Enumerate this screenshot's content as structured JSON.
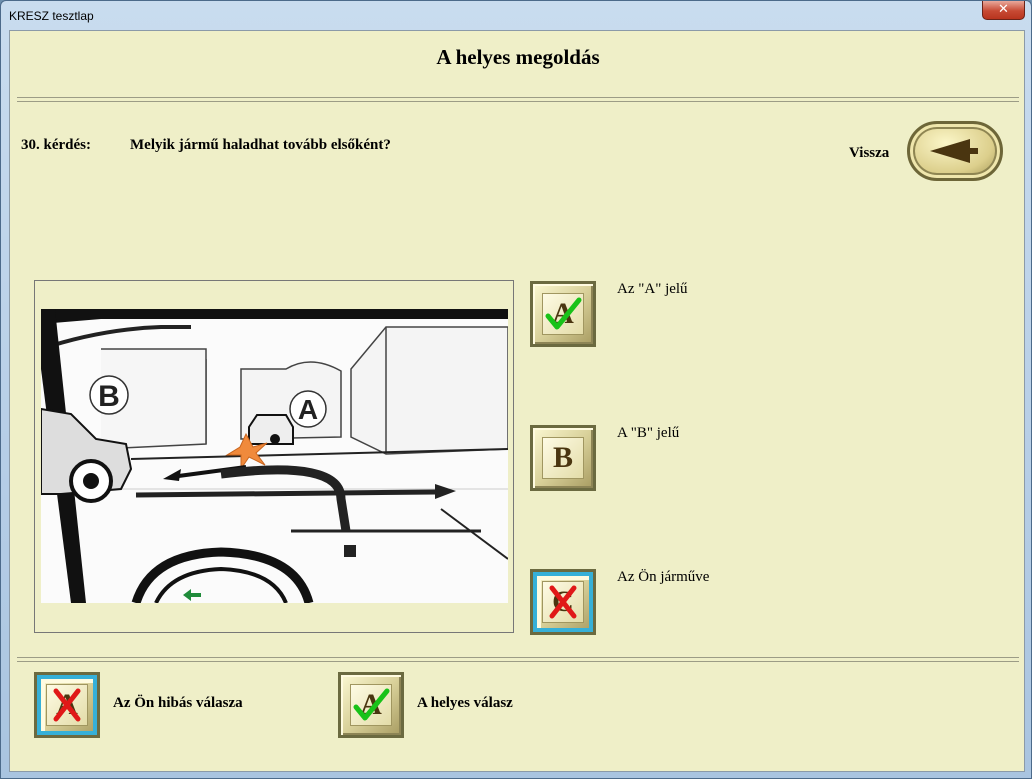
{
  "window": {
    "title": "KRESZ tesztlap",
    "close_glyph": "✕"
  },
  "header": {
    "title": "A helyes megoldás"
  },
  "question": {
    "number": "30.  kérdés:",
    "text": "Melyik jármű haladhat tovább elsőként?"
  },
  "back": {
    "label": "Vissza",
    "icon": "back-arrow-icon"
  },
  "picture": {
    "labels": [
      "B",
      "A"
    ]
  },
  "answers": [
    {
      "letter": "A",
      "text": "Az \"A\" jelű",
      "status": "correct"
    },
    {
      "letter": "B",
      "text": "A \"B\" jelű",
      "status": "neutral"
    },
    {
      "letter": "C",
      "text": "Az Ön járműve",
      "status": "wrong"
    }
  ],
  "legend": {
    "wrong": {
      "letter": "A",
      "label": "Az Ön hibás válasza"
    },
    "correct": {
      "letter": "A",
      "label": "A helyes válasz"
    }
  },
  "colors": {
    "background": "#efefc8",
    "correct_mark": "#19c219",
    "wrong_mark": "#e01818",
    "wrong_border": "#36b0d8"
  }
}
